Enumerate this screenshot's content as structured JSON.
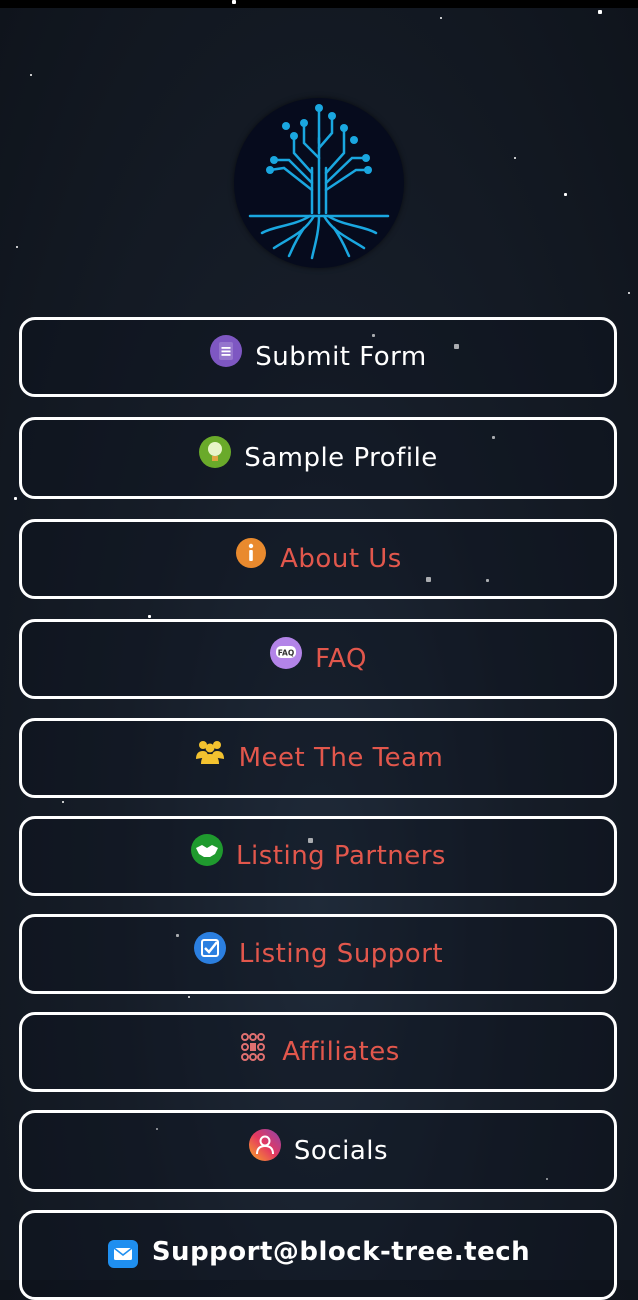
{
  "buttons": [
    {
      "label": "Submit Form",
      "icon": "form-icon",
      "color": "#ffffff"
    },
    {
      "label": "Sample Profile",
      "icon": "lightbulb-icon",
      "color": "#ffffff"
    },
    {
      "label": "About Us",
      "icon": "info-icon",
      "color": "#e2574c"
    },
    {
      "label": "FAQ",
      "icon": "faq-icon",
      "color": "#e2574c"
    },
    {
      "label": "Meet The Team",
      "icon": "team-icon",
      "color": "#e2574c"
    },
    {
      "label": "Listing Partners",
      "icon": "handshake-icon",
      "color": "#e2574c"
    },
    {
      "label": "Listing Support",
      "icon": "checkbox-icon",
      "color": "#e2574c"
    },
    {
      "label": "Affiliates",
      "icon": "network-icon",
      "color": "#e2574c"
    },
    {
      "label": "Socials",
      "icon": "user-icon",
      "color": "#ffffff"
    },
    {
      "label": "Support@block-tree.tech",
      "icon": "mail-icon",
      "color": "#ffffff"
    }
  ],
  "colors": {
    "background": "#161d28",
    "button_border": "#ffffff",
    "accent_red": "#e2574c",
    "logo_cyan": "#1aa7e0"
  }
}
